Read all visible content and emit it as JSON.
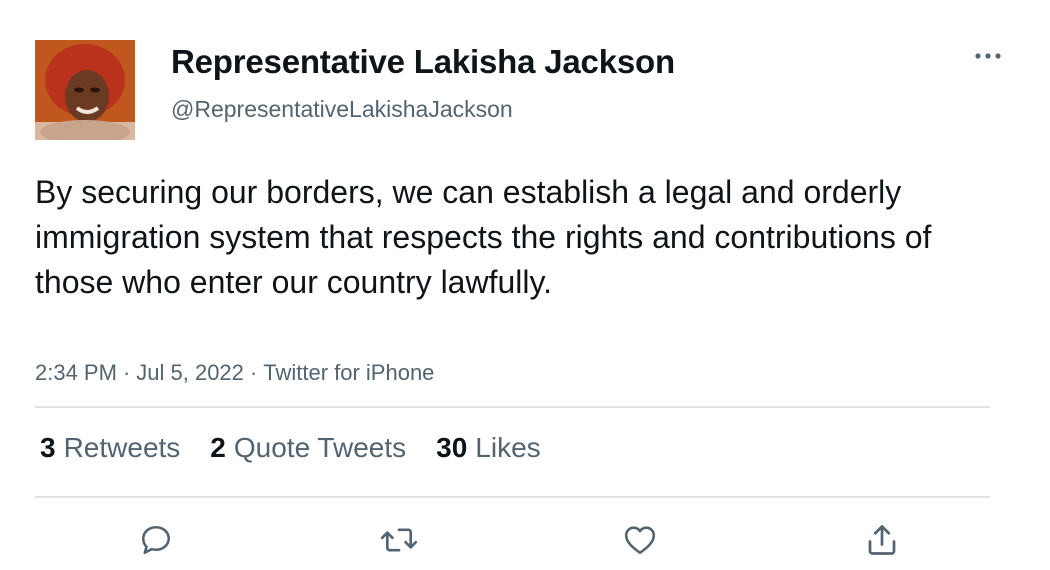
{
  "user": {
    "display_name": "Representative Lakisha Jackson",
    "handle": "@RepresentativeLakishaJackson"
  },
  "tweet": {
    "text": "By securing our borders, we can establish a legal and orderly immigration system that respects the rights and contributions of those who enter our country lawfully.",
    "time": "2:34 PM",
    "date": "Jul 5, 2022",
    "source": "Twitter for iPhone",
    "separator": "·"
  },
  "stats": {
    "retweets_count": "3",
    "retweets_label": "Retweets",
    "quotes_count": "2",
    "quotes_label": "Quote Tweets",
    "likes_count": "30",
    "likes_label": "Likes"
  },
  "icons": {
    "more": "more-horizontal-icon",
    "reply": "reply-icon",
    "retweet": "retweet-icon",
    "like": "heart-icon",
    "share": "share-icon"
  },
  "colors": {
    "text": "#0f1419",
    "secondary": "#536471",
    "divider": "#dfe3e6"
  }
}
